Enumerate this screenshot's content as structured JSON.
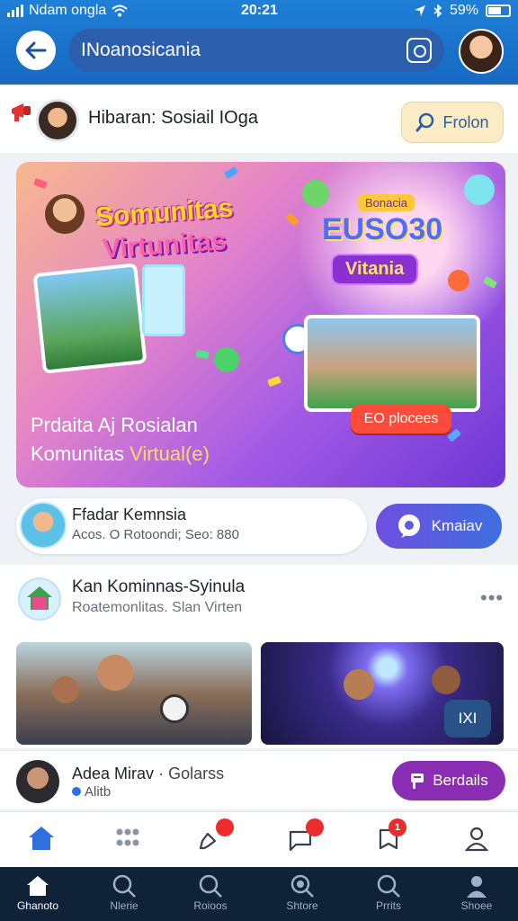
{
  "status": {
    "carrier": "Ndam ongla",
    "time": "20:21",
    "battery": "59%"
  },
  "header": {
    "search_value": "INoanosicania"
  },
  "group": {
    "title": "Hibaran: Sosiail IOga",
    "follow_label": "Frolon"
  },
  "banner": {
    "title_line1": "Somunitas",
    "title_line2": "Virtunitas",
    "small_label": "Bonacia",
    "badge_big": "EUSO30",
    "badge_sub": "Vitania",
    "cta_label": "EO plocees",
    "bottom_line1": "Prdaita Aj Rosialan",
    "bottom_line2_prefix": "Komunitas ",
    "bottom_line2_highlight": "Virtual(e)"
  },
  "member": {
    "name": "Ffadar Kemnsia",
    "sub": "Acos. O Rotoondi; Seo: 880",
    "join_label": "Kmaiav"
  },
  "post": {
    "title": "Kan Kominnas-Syinula",
    "sub": "Roatemonlitas. Slan Virten",
    "more": "•••",
    "thumb_badge": "IXI"
  },
  "author": {
    "name": "Adea Mirav",
    "group": "Golarss",
    "sub": "Alitb",
    "details_label": "Berdails"
  },
  "icon_row": {
    "badge_1": "1"
  },
  "bottom_nav": [
    {
      "label": "Ghanoto",
      "icon": "home-icon"
    },
    {
      "label": "Nlerie",
      "icon": "search-icon"
    },
    {
      "label": "Roioos",
      "icon": "search-icon"
    },
    {
      "label": "Shtore",
      "icon": "search-icon"
    },
    {
      "label": "Prrits",
      "icon": "search-icon"
    },
    {
      "label": "Shoee",
      "icon": "profile-icon"
    }
  ],
  "colors": {
    "header_blue": "#1769c2",
    "accent_purple": "#8b2db3",
    "notification_red": "#ee2b2b",
    "bottom_nav_bg": "#0f2238"
  }
}
